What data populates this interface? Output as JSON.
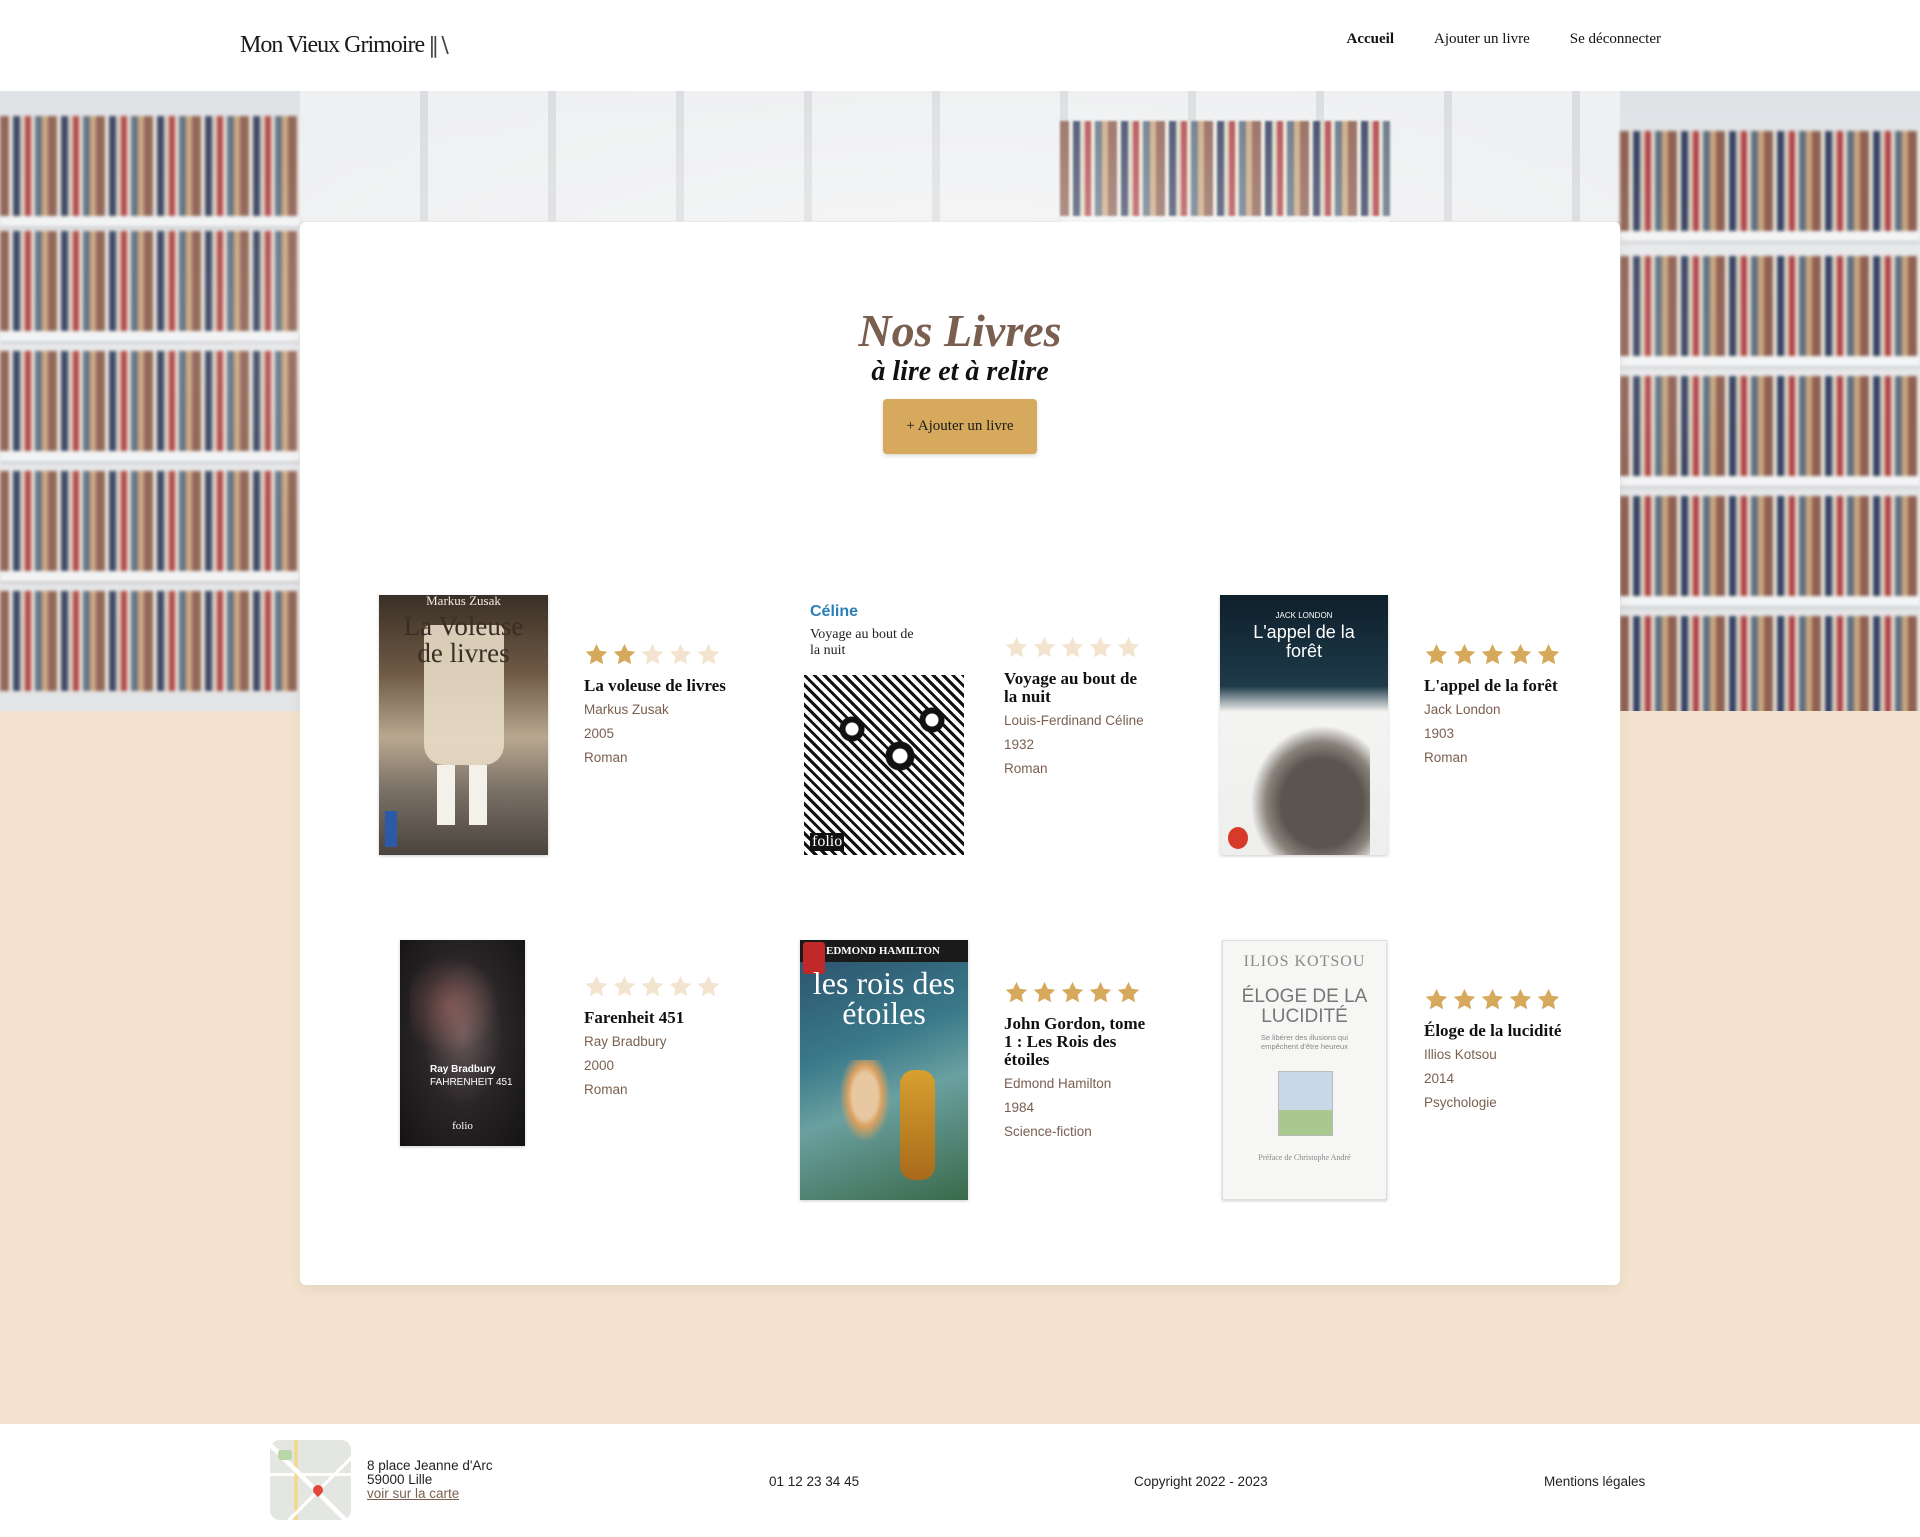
{
  "header": {
    "logo_text": "Mon Vieux Grimoire",
    "logo_icon": "books-icon",
    "nav": [
      {
        "label": "Accueil",
        "active": true
      },
      {
        "label": "Ajouter un livre",
        "active": false
      },
      {
        "label": "Se déconnecter",
        "active": false
      }
    ]
  },
  "main": {
    "title": "Nos Livres",
    "subtitle": "à lire et à relire",
    "add_button": "+ Ajouter un livre"
  },
  "books": [
    {
      "title": "La voleuse de livres",
      "author": "Markus Zusak",
      "year": "2005",
      "genre": "Roman",
      "rating": 2,
      "cover": {
        "top_text": "Markus Zusak",
        "main_text": "La Voleuse de livres"
      }
    },
    {
      "title": "Voyage au bout de la nuit",
      "author": "Louis-Ferdinand Céline",
      "year": "1932",
      "genre": "Roman",
      "rating": 0,
      "cover": {
        "top_text": "Céline",
        "main_text": "Voyage au bout de la nuit",
        "bottom_text": "folio"
      }
    },
    {
      "title": "L'appel de la forêt",
      "author": "Jack London",
      "year": "1903",
      "genre": "Roman",
      "rating": 5,
      "cover": {
        "top_text": "JACK LONDON",
        "main_text": "L'appel de la forêt"
      }
    },
    {
      "title": "Farenheit 451",
      "author": "Ray Bradbury",
      "year": "2000",
      "genre": "Roman",
      "rating": 0,
      "cover": {
        "top_text": "Ray Bradbury",
        "main_text": "FAHRENHEIT 451",
        "bottom_text": "folio"
      }
    },
    {
      "title": "John Gordon, tome 1 : Les Rois des étoiles",
      "author": "Edmond Hamilton",
      "year": "1984",
      "genre": "Science-fiction",
      "rating": 5,
      "cover": {
        "top_text": "EDMOND HAMILTON",
        "main_text": "les rois des étoiles"
      }
    },
    {
      "title": "Éloge de la lucidité",
      "author": "Illios Kotsou",
      "year": "2014",
      "genre": "Psychologie",
      "rating": 5,
      "cover": {
        "top_text": "ILIOS KOTSOU",
        "main_text": "ÉLOGE DE LA LUCIDITÉ",
        "sub_text": "Se libérer des illusions qui empêchent d'être heureux",
        "bottom_text": "Préface de Christophe André"
      }
    }
  ],
  "footer": {
    "address_line1": "8 place Jeanne d'Arc",
    "address_line2": "59000 Lille",
    "map_link": "voir sur la carte",
    "phone": "01 12 23 34 45",
    "copyright": "Copyright 2022 - 2023",
    "legal": "Mentions légales"
  },
  "colors": {
    "accent": "#d6a95c",
    "star_empty": "#f3e4cf",
    "text_brown": "#7a5f50",
    "beige_bg": "#f2e2ce"
  }
}
